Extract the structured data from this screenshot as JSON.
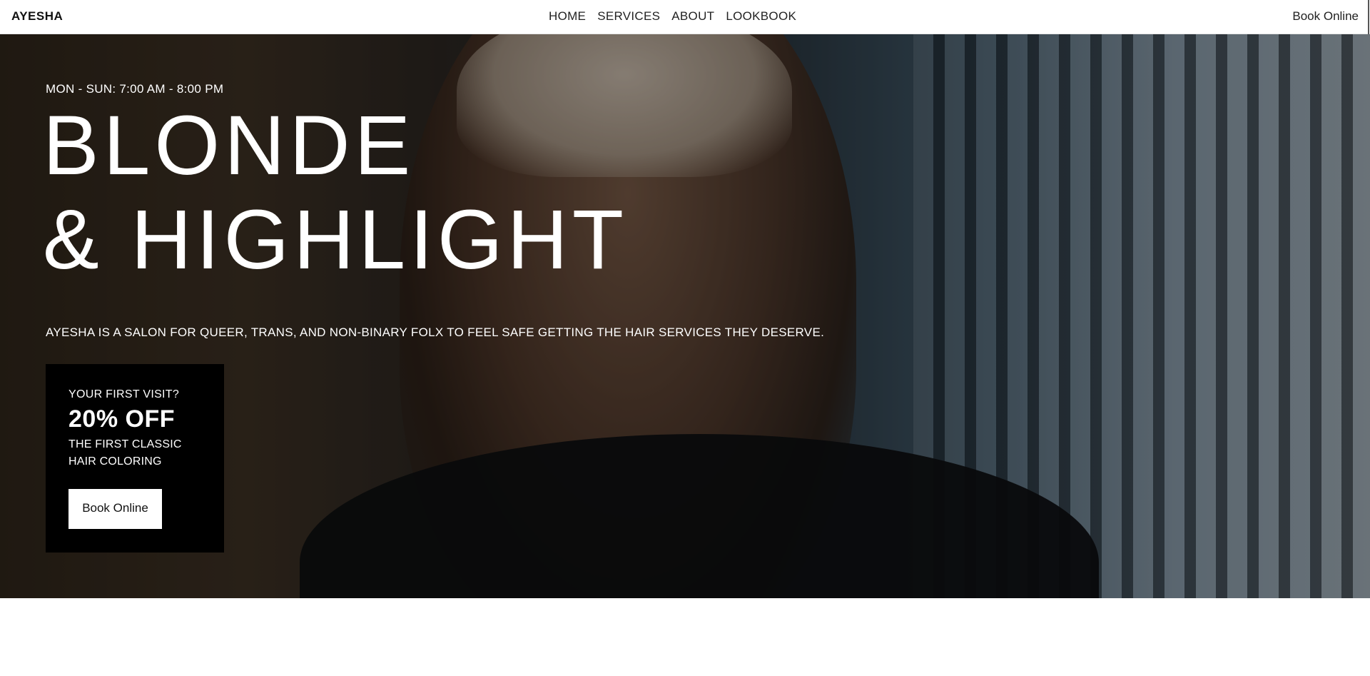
{
  "header": {
    "brand": "AYESHA",
    "nav": [
      {
        "label": "HOME"
      },
      {
        "label": "SERVICES"
      },
      {
        "label": "ABOUT"
      },
      {
        "label": "LOOKBOOK"
      }
    ],
    "book_label": "Book Online"
  },
  "hero": {
    "hours": "MON - SUN: 7:00 AM - 8:00 PM",
    "headline_line1": "BLONDE",
    "headline_line2": "& HIGHLIGHT",
    "tagline": "AYESHA IS A SALON FOR QUEER, TRANS, AND NON-BINARY FOLX TO FEEL SAFE GETTING THE HAIR SERVICES THEY DESERVE.",
    "promo": {
      "question": "YOUR FIRST VISIT?",
      "discount": "20% OFF",
      "description": "THE FIRST CLASSIC HAIR COLORING",
      "button_label": "Book Online"
    }
  },
  "colors": {
    "header_bg": "#ffffff",
    "promo_bg": "#000000",
    "hero_text": "#ffffff"
  }
}
